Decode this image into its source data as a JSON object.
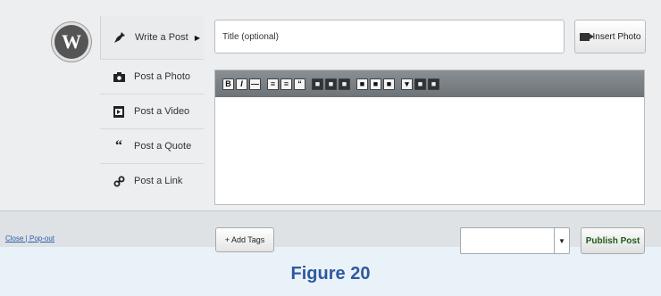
{
  "menu": {
    "items": [
      {
        "label": "Write a Post",
        "icon": "pin-icon"
      },
      {
        "label": "Post a Photo",
        "icon": "camera-icon"
      },
      {
        "label": "Post a Video",
        "icon": "video-icon"
      },
      {
        "label": "Post a Quote",
        "icon": "quote-icon"
      },
      {
        "label": "Post a Link",
        "icon": "link-icon"
      }
    ]
  },
  "editor": {
    "title_placeholder": "Title (optional)",
    "insert_photo_label": "Insert Photo",
    "toolbar": [
      "B",
      "I",
      "—",
      "≡",
      "≡",
      "“",
      "■",
      "■",
      "■",
      "■",
      "■",
      "■",
      "▾",
      "■",
      "■"
    ]
  },
  "footer": {
    "close_popout": "Close | Pop-out",
    "add_tags_label": "+ Add Tags",
    "select_value": "",
    "publish_label": "Publish Post"
  },
  "caption": "Figure 20",
  "colors": {
    "publish_text": "#1f5a16",
    "caption": "#2d59a0",
    "toolbar": "#7a7f83"
  }
}
